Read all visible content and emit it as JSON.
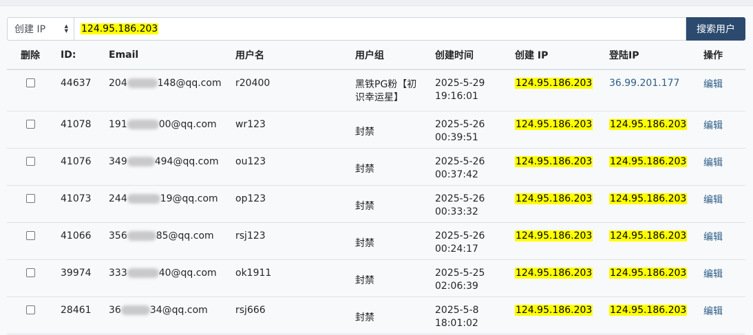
{
  "search": {
    "field_selected": "创建 IP",
    "query": "124.95.186.203",
    "button_label": "搜索用户"
  },
  "table": {
    "headers": [
      "删除",
      "ID:",
      "Email",
      "用户名",
      "用户组",
      "创建时间",
      "创建 IP",
      "登陆IP",
      "操作"
    ],
    "rows": [
      {
        "id": "44637",
        "email_prefix": "204",
        "email_suffix": "148@qq.com",
        "username": "r20400",
        "group": "黑铁PG粉【初识幸运星】",
        "created_date": "2025-5-29",
        "created_time": "19:16:01",
        "create_ip": "124.95.186.203",
        "login_ip": "36.99.201.177",
        "login_ip_highlight": false,
        "action": "编辑"
      },
      {
        "id": "41078",
        "email_prefix": "191",
        "email_suffix": "00@qq.com",
        "username": "wr123",
        "group": "封禁",
        "created_date": "2025-5-26",
        "created_time": "00:39:51",
        "create_ip": "124.95.186.203",
        "login_ip": "124.95.186.203",
        "login_ip_highlight": true,
        "action": "编辑"
      },
      {
        "id": "41076",
        "email_prefix": "349",
        "email_suffix": "494@qq.com",
        "username": "ou123",
        "group": "封禁",
        "created_date": "2025-5-26",
        "created_time": "00:37:42",
        "create_ip": "124.95.186.203",
        "login_ip": "124.95.186.203",
        "login_ip_highlight": true,
        "action": "编辑"
      },
      {
        "id": "41073",
        "email_prefix": "244",
        "email_suffix": "19@qq.com",
        "username": "op123",
        "group": "封禁",
        "created_date": "2025-5-26",
        "created_time": "00:33:32",
        "create_ip": "124.95.186.203",
        "login_ip": "124.95.186.203",
        "login_ip_highlight": true,
        "action": "编辑"
      },
      {
        "id": "41066",
        "email_prefix": "356",
        "email_suffix": "85@qq.com",
        "username": "rsj123",
        "group": "封禁",
        "created_date": "2025-5-26",
        "created_time": "00:24:17",
        "create_ip": "124.95.186.203",
        "login_ip": "124.95.186.203",
        "login_ip_highlight": true,
        "action": "编辑"
      },
      {
        "id": "39974",
        "email_prefix": "333",
        "email_suffix": "40@qq.com",
        "username": "ok1911",
        "group": "封禁",
        "created_date": "2025-5-25",
        "created_time": "02:06:39",
        "create_ip": "124.95.186.203",
        "login_ip": "124.95.186.203",
        "login_ip_highlight": true,
        "action": "编辑"
      },
      {
        "id": "28461",
        "email_prefix": "36",
        "email_suffix": "34@qq.com",
        "username": "rsj666",
        "group": "封禁",
        "created_date": "2025-5-8",
        "created_time": "18:01:02",
        "create_ip": "124.95.186.203",
        "login_ip": "124.95.186.203",
        "login_ip_highlight": true,
        "action": "编辑"
      }
    ]
  },
  "colors": {
    "highlight": "#ffff00",
    "button": "#2c4a6e",
    "link": "#2c5d88"
  }
}
